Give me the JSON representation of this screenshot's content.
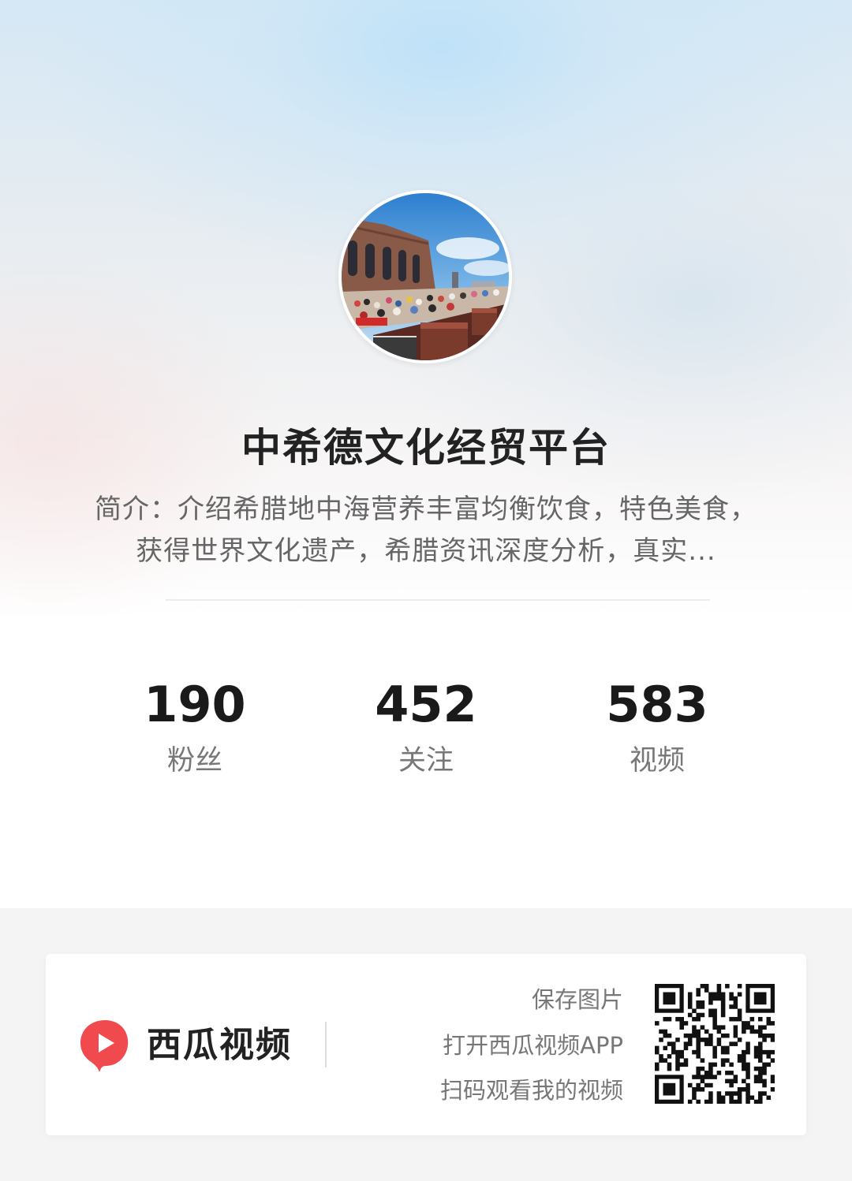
{
  "profile": {
    "name": "中希德文化经贸平台",
    "bio": "简介：介绍希腊地中海营养丰富均衡饮食，特色美食，获得世界文化遗产，希腊资讯深度分析，真实..."
  },
  "stats": [
    {
      "value": "190",
      "label": "粉丝"
    },
    {
      "value": "452",
      "label": "关注"
    },
    {
      "value": "583",
      "label": "视频"
    }
  ],
  "share_card": {
    "brand": "西瓜视频",
    "actions": [
      "保存图片",
      "打开西瓜视频APP",
      "扫码观看我的视频"
    ]
  },
  "colors": {
    "brand_red": "#f04a4f"
  },
  "icons": {
    "brand_logo": "xigua-video-logo",
    "qr": "qr-code"
  }
}
